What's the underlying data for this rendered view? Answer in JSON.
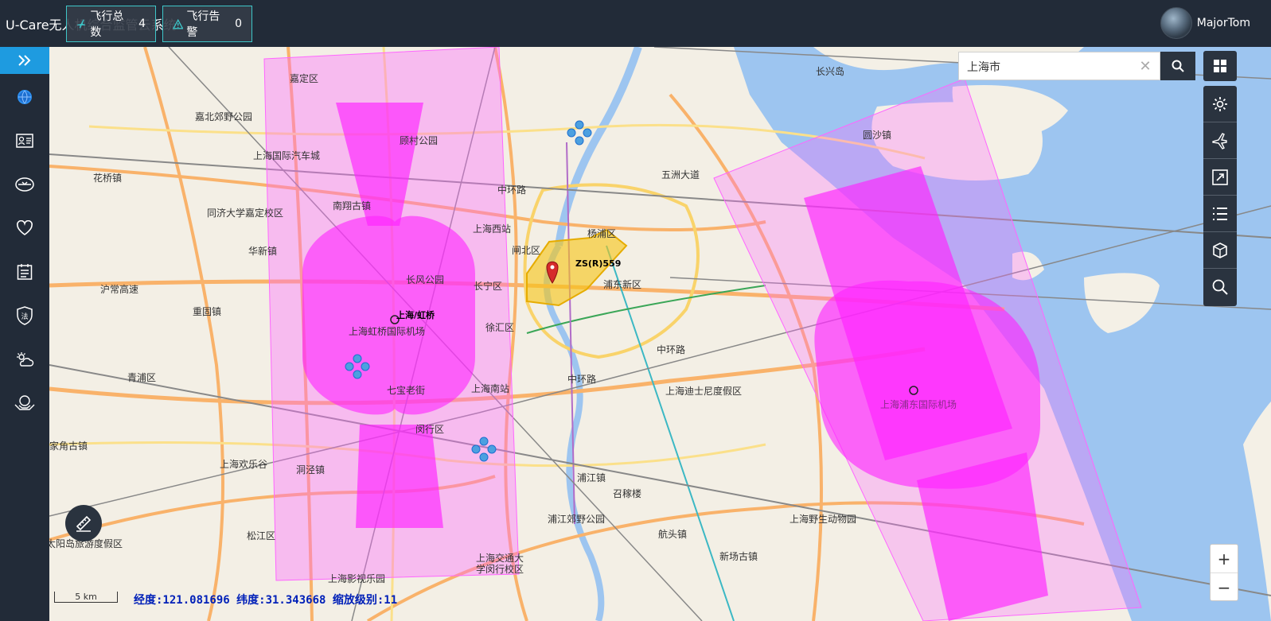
{
  "header": {
    "title": "U-Care无人机综合监管云系统",
    "username": "MajorTom"
  },
  "sidebar": {
    "items": [
      {
        "icon": "globe-icon"
      },
      {
        "icon": "id-card-icon"
      },
      {
        "icon": "drone-icon"
      },
      {
        "icon": "heart-icon"
      },
      {
        "icon": "calendar-icon"
      },
      {
        "icon": "law-shield-icon"
      },
      {
        "icon": "weather-icon"
      },
      {
        "icon": "hands-icon"
      }
    ]
  },
  "stats": {
    "flights_label": "飞行总数",
    "flights_value": "4",
    "alerts_label": "飞行告警",
    "alerts_value": "0"
  },
  "search": {
    "value": "上海市"
  },
  "tools": [
    "settings-icon",
    "plane-icon",
    "expand-icon",
    "list-icon",
    "box-icon",
    "magnifier-icon"
  ],
  "map": {
    "labels": [
      {
        "text": "嘉定区"
      },
      {
        "text": "嘉北郊野公园"
      },
      {
        "text": "顾村公园"
      },
      {
        "text": "上海国际汽车城"
      },
      {
        "text": "花桥镇"
      },
      {
        "text": "同济大学嘉定校区"
      },
      {
        "text": "南翔古镇"
      },
      {
        "text": "上海西站"
      },
      {
        "text": "中环路"
      },
      {
        "text": "五洲大道"
      },
      {
        "text": "杨浦区"
      },
      {
        "text": "闸北区"
      },
      {
        "text": "长宁区"
      },
      {
        "text": "浦东新区"
      },
      {
        "text": "长兴岛"
      },
      {
        "text": "圆沙镇"
      },
      {
        "text": "华新镇"
      },
      {
        "text": "沪常高速"
      },
      {
        "text": "重固镇"
      },
      {
        "text": "长风公园"
      },
      {
        "text": "上海虹桥国际机场"
      },
      {
        "text": "徐汇区"
      },
      {
        "text": "上海南站"
      },
      {
        "text": "七宝老街"
      },
      {
        "text": "青浦区"
      },
      {
        "text": "上海迪士尼度假区"
      },
      {
        "text": "闵行区"
      },
      {
        "text": "上海欢乐谷"
      },
      {
        "text": "洞泾镇"
      },
      {
        "text": "浦江镇"
      },
      {
        "text": "召稼楼"
      },
      {
        "text": "浦江郊野公园"
      },
      {
        "text": "航头镇"
      },
      {
        "text": "新场古镇"
      },
      {
        "text": "上海野生动物园"
      },
      {
        "text": "上海交通大学闵行校区"
      },
      {
        "text": "松江区"
      },
      {
        "text": "上海影视乐园"
      },
      {
        "text": "太阳岛旅游度假区"
      },
      {
        "text": "中环路"
      },
      {
        "text": "上海浦东国际机场"
      },
      {
        "text": "家角古镇"
      },
      {
        "text": "中环路"
      }
    ],
    "zones": [
      {
        "text": "上海/虹桥"
      },
      {
        "text": "ZS(R)559"
      }
    ],
    "scale": "5 km",
    "coords": "经度:121.081696 纬度:31.343668 缩放级别:11"
  },
  "colors": {
    "topbar": "#222b38",
    "accent": "#1e9be0",
    "zone": "#ff33ff",
    "restricted": "#f5c518"
  }
}
